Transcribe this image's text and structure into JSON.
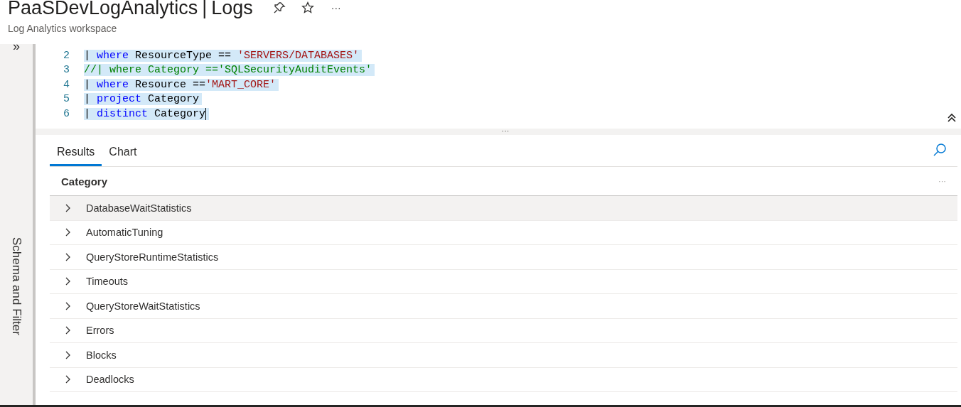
{
  "header": {
    "title": "PaaSDevLogAnalytics",
    "separator": "|",
    "title_suffix": "Logs",
    "subtitle": "Log Analytics workspace",
    "more": "···"
  },
  "sidebar": {
    "toggle": "»",
    "label": "Schema and Filter"
  },
  "editor": {
    "lines": [
      {
        "number": "2",
        "selected": true,
        "tokens": [
          {
            "kind": "plain",
            "text": "| "
          },
          {
            "kind": "keyword",
            "text": "where"
          },
          {
            "kind": "plain",
            "text": " ResourceType == "
          },
          {
            "kind": "string",
            "text": "'SERVERS/DATABASES'"
          }
        ]
      },
      {
        "number": "3",
        "selected": true,
        "tokens": [
          {
            "kind": "comment",
            "text": "//| where Category =='SQLSecurityAuditEvents'"
          }
        ]
      },
      {
        "number": "4",
        "selected": true,
        "tokens": [
          {
            "kind": "plain",
            "text": "| "
          },
          {
            "kind": "keyword",
            "text": "where"
          },
          {
            "kind": "plain",
            "text": " Resource =="
          },
          {
            "kind": "string",
            "text": "'MART_CORE'"
          }
        ]
      },
      {
        "number": "5",
        "selected": true,
        "tokens": [
          {
            "kind": "plain",
            "text": "| "
          },
          {
            "kind": "keyword",
            "text": "project"
          },
          {
            "kind": "plain",
            "text": " Category"
          }
        ]
      },
      {
        "number": "6",
        "selected": true,
        "tokens": [
          {
            "kind": "plain",
            "text": "| "
          },
          {
            "kind": "keyword",
            "text": "distinct"
          },
          {
            "kind": "plain",
            "text": " Category"
          }
        ]
      }
    ],
    "splitter": "···"
  },
  "tabs": [
    {
      "label": "Results",
      "selected": true
    },
    {
      "label": "Chart",
      "selected": false
    }
  ],
  "table": {
    "columns": [
      "Category"
    ],
    "column_menu": "···",
    "rows": [
      {
        "cells": [
          "DatabaseWaitStatistics"
        ],
        "selected": true
      },
      {
        "cells": [
          "AutomaticTuning"
        ],
        "selected": false
      },
      {
        "cells": [
          "QueryStoreRuntimeStatistics"
        ],
        "selected": false
      },
      {
        "cells": [
          "Timeouts"
        ],
        "selected": false
      },
      {
        "cells": [
          "QueryStoreWaitStatistics"
        ],
        "selected": false
      },
      {
        "cells": [
          "Errors"
        ],
        "selected": false
      },
      {
        "cells": [
          "Blocks"
        ],
        "selected": false
      },
      {
        "cells": [
          "Deadlocks"
        ],
        "selected": false
      }
    ]
  }
}
